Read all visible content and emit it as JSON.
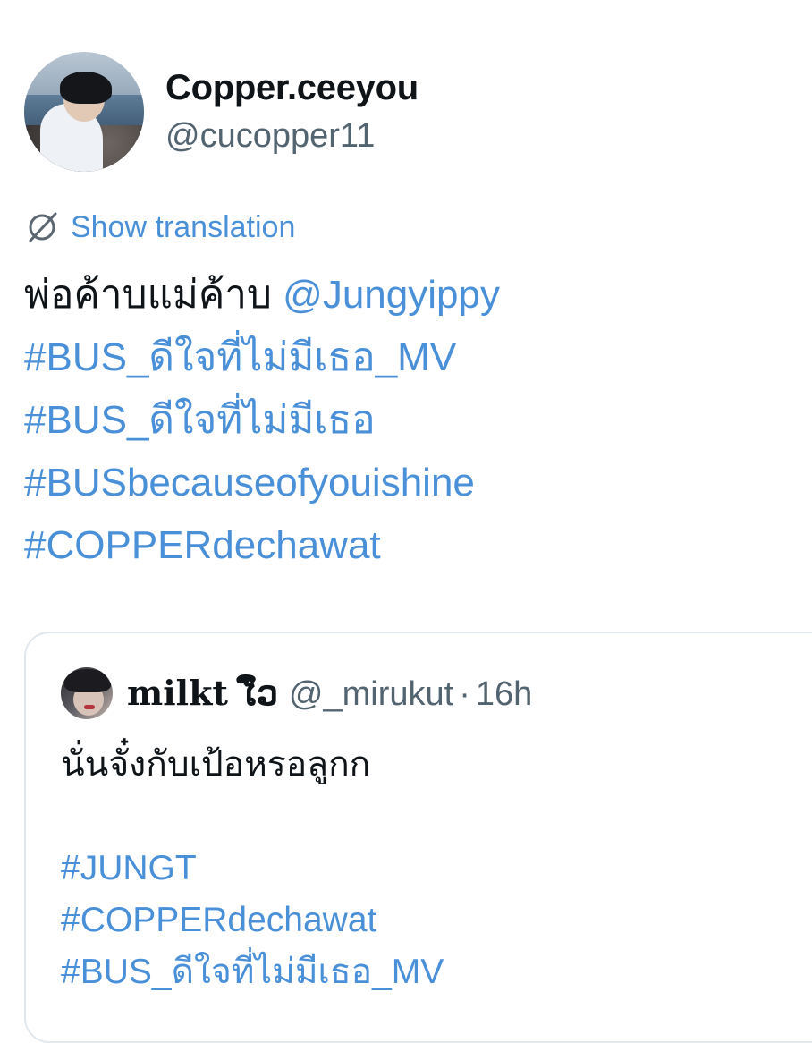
{
  "tweet": {
    "display_name": "Copper.ceeyou",
    "handle": "@cucopper11",
    "translate_label": "Show translation",
    "body_lines": [
      {
        "text": "พ่อค้าบแม่ค้าบ ",
        "mention": "@Jungyippy"
      },
      {
        "hashtag": "#BUS_ดีใจที่ไม่มีเธอ_MV"
      },
      {
        "hashtag": "#BUS_ดีใจที่ไม่มีเธอ"
      },
      {
        "hashtag": "#BUSbecauseofyouishine"
      },
      {
        "hashtag": "#COPPERdechawat"
      }
    ]
  },
  "quoted_tweet": {
    "display_name": "milkt ໄ໋ົວ",
    "handle": "@_mirukut",
    "separator": "·",
    "time": "16h",
    "body_lines": [
      {
        "text": "นั่นจั๋งกับเป้อหรอลูกก"
      },
      {
        "text": ""
      },
      {
        "hashtag": "#JUNGT"
      },
      {
        "hashtag": "#COPPERdechawat"
      },
      {
        "hashtag": "#BUS_ดีใจที่ไม่มีเธอ_MV"
      }
    ]
  },
  "icons": {
    "translate": "globe-slash-icon"
  },
  "colors": {
    "link": "#4a90d9",
    "text": "#0f1419",
    "secondary": "#536471",
    "border": "#e1e8ed"
  }
}
